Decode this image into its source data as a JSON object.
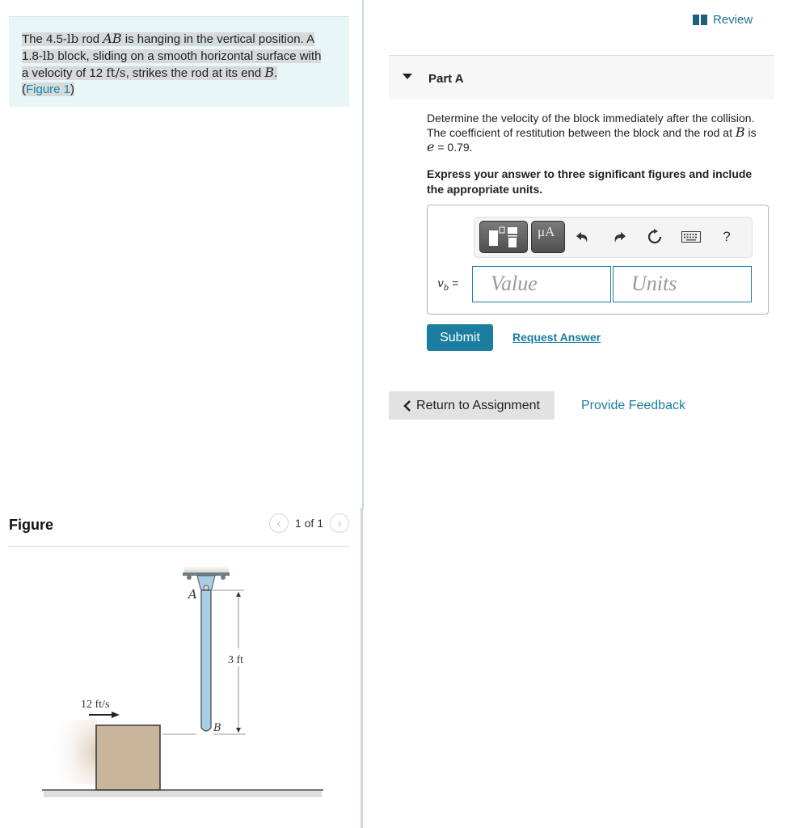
{
  "problem": {
    "line1_a": "The 4.5-",
    "unit_lb": "lb",
    "line1_b": " rod ",
    "rod_name": "AB",
    "line1_c": " is hanging in the vertical position. A",
    "line2_a": "1.8-",
    "line2_b": " block, sliding on a smooth horizontal surface with",
    "line3_a": "a velocity of 12 ",
    "unit_fts": "ft/s",
    "line3_b": ", strikes the rod at its end ",
    "end_name": "B",
    "line3_c": ".",
    "figure_link_open": "(",
    "figure_link": "Figure 1",
    "figure_link_close": ")"
  },
  "figure_panel": {
    "title": "Figure",
    "pager_text": "1 of 1",
    "prev_icon": "chevron-left-icon",
    "next_icon": "chevron-right-icon",
    "diagram": {
      "label_A": "A",
      "label_B": "B",
      "dimension": "3 ft",
      "velocity": "12 ft/s",
      "colors": {
        "rod": "#a8cde6",
        "block": "#c9b49c",
        "ground": "#c8c8c8"
      }
    }
  },
  "review": {
    "label": "Review",
    "icon": "book-icon"
  },
  "part": {
    "title": "Part A",
    "question_a": "Determine the velocity of the block immediately after the collision. The coefficient of restitution between the block and the rod at ",
    "question_point": "B",
    "question_b": " is ",
    "question_e": "e",
    "question_c": " = 0.79.",
    "instruction": "Express your answer to three significant figures and include the appropriate units."
  },
  "answer": {
    "toolbar": {
      "templates_icon": "templates-icon",
      "units_btn": "μA",
      "undo_icon": "undo-icon",
      "redo_icon": "redo-icon",
      "reset_icon": "reset-icon",
      "keyboard_icon": "keyboard-icon",
      "help": "?"
    },
    "var_name": "v",
    "var_sub": "b",
    "equals": "=",
    "value_placeholder": "Value",
    "units_placeholder": "Units"
  },
  "actions": {
    "submit": "Submit",
    "request_answer": "Request Answer",
    "return": "Return to Assignment",
    "feedback": "Provide Feedback"
  },
  "colors": {
    "accent": "#1b7ea0",
    "link": "#1a84b2",
    "problem_bg": "#e8f6f8"
  }
}
